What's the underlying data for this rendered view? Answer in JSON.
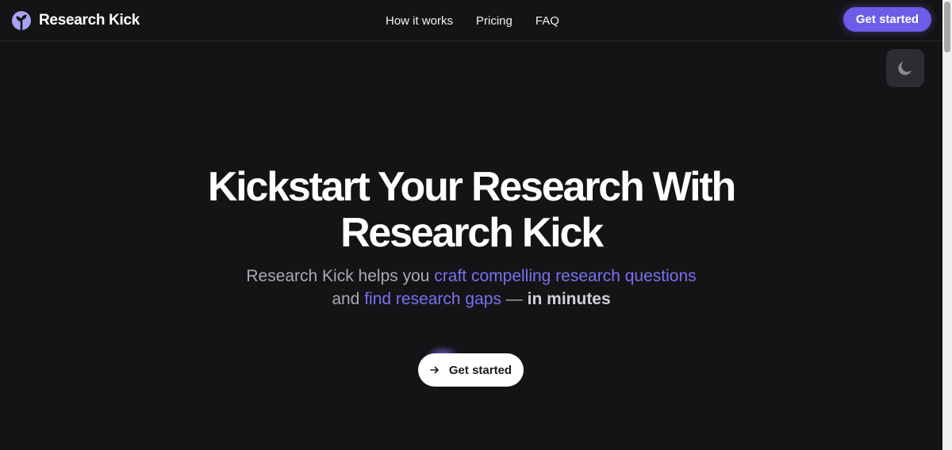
{
  "brand": {
    "name": "Research Kick",
    "logo_icon": "research-kick-logo-icon",
    "logo_color": "#a9a2f2"
  },
  "nav": {
    "links": [
      "How it works",
      "Pricing",
      "FAQ"
    ],
    "cta_label": "Get started"
  },
  "theme_toggle": {
    "icon": "moon-icon"
  },
  "hero": {
    "title_line1": "Kickstart Your Research With",
    "title_line2": "Research Kick",
    "subtitle": {
      "part1": "Research Kick helps you ",
      "link1": "craft compelling research questions",
      "part2": "and ",
      "link2": "find research gaps",
      "part3": " — ",
      "bold": "in minutes"
    },
    "cta_label": "Get started",
    "cta_icon": "arrow-right-icon"
  },
  "colors": {
    "background": "#141416",
    "accent": "#6c5ce7",
    "accent_text": "#7d6ff0"
  }
}
